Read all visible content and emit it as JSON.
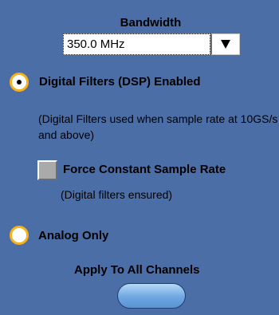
{
  "bandwidth": {
    "title": "Bandwidth",
    "selected_value": "350.0 MHz",
    "dropdown_icon": "triangle-down-icon"
  },
  "dsp": {
    "label": "Digital Filters (DSP) Enabled",
    "selected": true,
    "note": "(Digital Filters used when sample rate at 10GS/s and above)"
  },
  "constant_rate": {
    "label": "Force Constant Sample Rate",
    "checked": false,
    "note": "(Digital filters ensured)"
  },
  "analog": {
    "label": "Analog Only",
    "selected": false
  },
  "apply": {
    "label": "Apply To All Channels"
  },
  "colors": {
    "background": "#4c6ea7",
    "radio_ring": "#f5b21a",
    "button_top": "#b6d8f6",
    "button_bottom": "#5b93d3"
  }
}
